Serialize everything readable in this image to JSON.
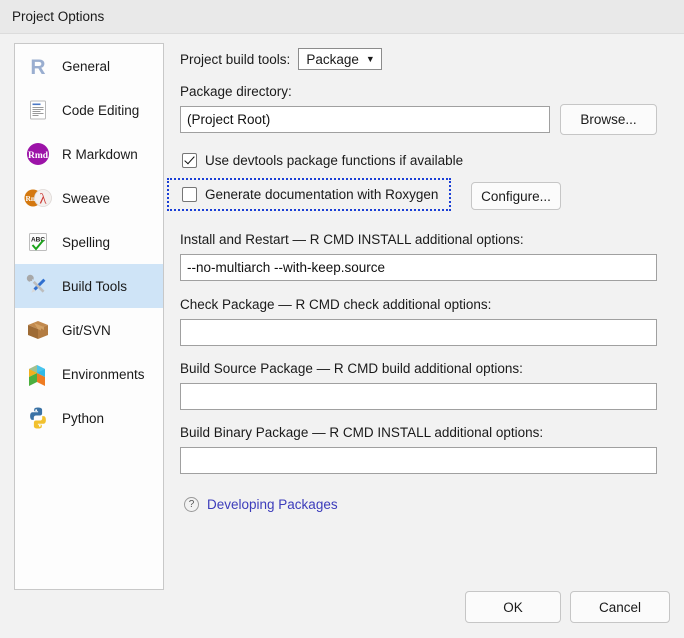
{
  "window": {
    "title": "Project Options"
  },
  "sidebar": {
    "items": [
      {
        "label": "General",
        "icon": "r-logo-icon",
        "selected": false
      },
      {
        "label": "Code Editing",
        "icon": "document-icon",
        "selected": false
      },
      {
        "label": "R Markdown",
        "icon": "rmd-icon",
        "selected": false
      },
      {
        "label": "Sweave",
        "icon": "rnw-pdf-icon",
        "selected": false
      },
      {
        "label": "Spelling",
        "icon": "abc-check-icon",
        "selected": false
      },
      {
        "label": "Build Tools",
        "icon": "tools-icon",
        "selected": true
      },
      {
        "label": "Git/SVN",
        "icon": "box-icon",
        "selected": false
      },
      {
        "label": "Environments",
        "icon": "cube-icon",
        "selected": false
      },
      {
        "label": "Python",
        "icon": "python-icon",
        "selected": false
      }
    ]
  },
  "main": {
    "build_tools_label": "Project build tools:",
    "build_tools_value": "Package",
    "build_tools_caret": "▼",
    "package_directory_label": "Package directory:",
    "package_directory_value": "(Project Root)",
    "browse_label": "Browse...",
    "devtools_checkbox_label": "Use devtools package functions if available",
    "devtools_checked": true,
    "roxygen_checkbox_label": "Generate documentation with Roxygen",
    "roxygen_checked": false,
    "configure_label": "Configure...",
    "install_restart_label": "Install and Restart — R CMD INSTALL additional options:",
    "install_restart_value": "--no-multiarch --with-keep.source",
    "check_package_label": "Check Package — R CMD check additional options:",
    "check_package_value": "",
    "build_source_label": "Build Source Package — R CMD build additional options:",
    "build_source_value": "",
    "build_binary_label": "Build Binary Package — R CMD INSTALL additional options:",
    "build_binary_value": "",
    "help_icon": "question-mark-icon",
    "help_link_label": "Developing Packages"
  },
  "footer": {
    "ok_label": "OK",
    "cancel_label": "Cancel"
  },
  "colors": {
    "selection_blue": "#cfe4f7",
    "focus_outline": "#1b3fd6",
    "link": "#3c3cbb",
    "dialog_bg": "#f2f2f2",
    "titlebar_bg": "#e9e9e9"
  }
}
